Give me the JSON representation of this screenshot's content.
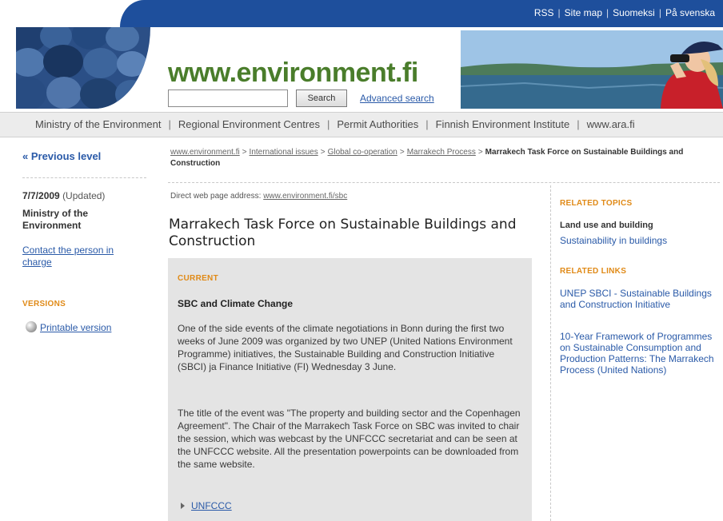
{
  "utility_nav": {
    "items": [
      "RSS",
      "Site map",
      "Suomeksi",
      "På svenska"
    ],
    "separator": "|"
  },
  "header": {
    "site_title": "www.environment.fi",
    "search_placeholder": "",
    "search_button": "Search",
    "advanced_search": "Advanced search"
  },
  "org_nav": {
    "items": [
      "Ministry of the Environment",
      "Regional Environment Centres",
      "Permit Authorities",
      "Finnish Environment Institute",
      "www.ara.fi"
    ],
    "separator": "|"
  },
  "left": {
    "previous_level": "« Previous level",
    "date": "7/7/2009",
    "updated": "(Updated)",
    "organization": "Ministry of the Environment",
    "contact_link": "Contact the person in charge",
    "versions_label": "VERSIONS",
    "printable_version": "Printable version"
  },
  "breadcrumb": {
    "items": [
      "www.environment.fi",
      "International issues",
      "Global co-operation",
      "Marrakech Process"
    ],
    "separator": ">",
    "current": "Marrakech Task Force on Sustainable Buildings and Construction"
  },
  "main": {
    "direct_address_label": "Direct web page address:",
    "direct_address_url": "www.environment.fi/sbc",
    "title": "Marrakech Task Force on Sustainable Buildings and Construction",
    "current_label": "CURRENT",
    "current_heading": "SBC and Climate Change",
    "paragraph1": "One of the side events of the climate negotiations in Bonn during the first two weeks of June 2009 was organized by two UNEP (United Nations Environment Programme) initiatives, the Sustainable Building and Construction Initiative (SBCI) ja Finance Initiative (FI) Wednesday 3 June.",
    "paragraph2": "The title of the event was \"The property and building sector and the Copenhagen Agreement\". The Chair of the Marrakech Task Force on SBC was invited to chair the session, which was webcast by the UNFCCC secretariat and can be seen at the UNFCCC website. All the presentation powerpoints can be downloaded from the same website.",
    "link_unfccc": "UNFCCC"
  },
  "right": {
    "related_topics_label": "RELATED TOPICS",
    "topic_strong": "Land use and building",
    "topic_link": "Sustainability in buildings",
    "related_links_label": "RELATED LINKS",
    "link1": "UNEP SBCI - Sustainable Buildings and Construction Initiative",
    "link2": "10-Year Framework of Programmes on Sustainable Consumption and Production Patterns: The Marrakech Process",
    "link2_suffix": "(United Nations)"
  },
  "colors": {
    "top_bar": "#1e4f9c",
    "site_title": "#4a7d2b",
    "accent_orange": "#e08a17",
    "link": "#2a5aa8",
    "content_box": "#e4e4e4"
  }
}
